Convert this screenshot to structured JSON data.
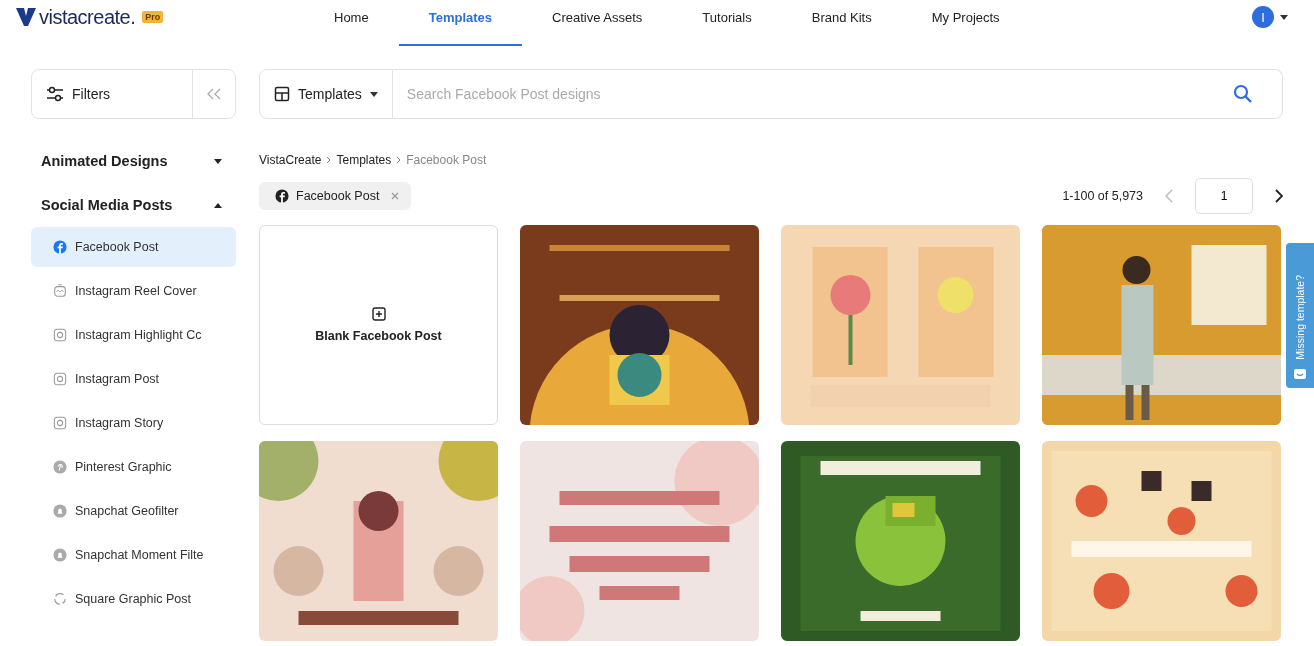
{
  "header": {
    "logo": "vistacreate.",
    "badge": "Pro",
    "nav": [
      {
        "label": "Home",
        "selected": false
      },
      {
        "label": "Templates",
        "selected": true
      },
      {
        "label": "Creative Assets",
        "selected": false
      },
      {
        "label": "Tutorials",
        "selected": false
      },
      {
        "label": "Brand Kits",
        "selected": false
      },
      {
        "label": "My Projects",
        "selected": false
      }
    ],
    "avatar": "I"
  },
  "filters": {
    "label": "Filters"
  },
  "search": {
    "category": "Templates",
    "placeholder": "Search Facebook Post designs"
  },
  "sidebar": {
    "sections": [
      {
        "title": "Animated Designs",
        "expanded": false
      },
      {
        "title": "Social Media Posts",
        "expanded": true,
        "items": [
          {
            "label": "Facebook Post",
            "kind": "facebook",
            "selected": true
          },
          {
            "label": "Instagram Reel Cover",
            "kind": "reel",
            "selected": false
          },
          {
            "label": "Instagram Highlight Cc",
            "kind": "instagram",
            "selected": false
          },
          {
            "label": "Instagram Post",
            "kind": "instagram",
            "selected": false
          },
          {
            "label": "Instagram Story",
            "kind": "instagram",
            "selected": false
          },
          {
            "label": "Pinterest Graphic",
            "kind": "pinterest",
            "selected": false
          },
          {
            "label": "Snapchat Geofilter",
            "kind": "snapchat",
            "selected": false
          },
          {
            "label": "Snapchat Moment Filte",
            "kind": "snapchat",
            "selected": false
          },
          {
            "label": "Square Graphic Post",
            "kind": "square",
            "selected": false
          }
        ]
      }
    ]
  },
  "breadcrumb": [
    "VistaCreate",
    "Templates",
    "Facebook Post"
  ],
  "chip": {
    "label": "Facebook Post"
  },
  "pagination": {
    "range": "1-100 of 5,973",
    "page": "1"
  },
  "cards": [
    {
      "kind": "blank",
      "label": "Blank Facebook Post"
    },
    {
      "kind": "picture"
    },
    {
      "kind": "picture"
    },
    {
      "kind": "picture"
    },
    {
      "kind": "picture"
    },
    {
      "kind": "picture"
    },
    {
      "kind": "picture"
    },
    {
      "kind": "picture"
    }
  ],
  "feedback_tab": {
    "label": "Missing template?"
  }
}
